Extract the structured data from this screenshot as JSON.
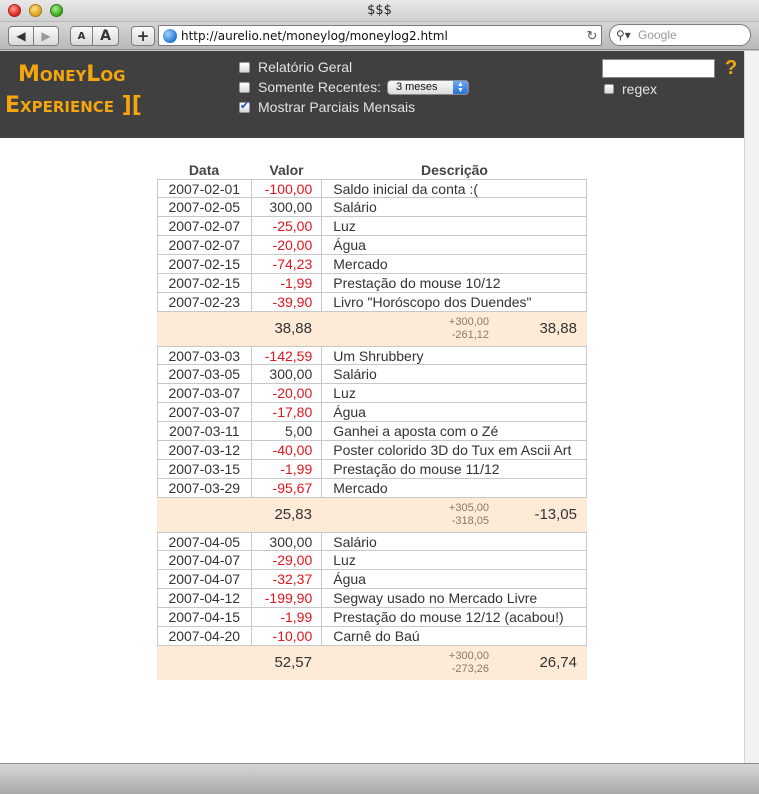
{
  "window": {
    "title": "$$$"
  },
  "toolbar": {
    "back_icon": "◀",
    "forward_icon": "▶",
    "font_smaller": "A",
    "font_larger": "A",
    "add_label": "+",
    "url": "http://aurelio.net/moneylog/moneylog2.html",
    "reload_icon": "↻",
    "search_placeholder": "Google"
  },
  "header": {
    "logo_line1": "MoneyLog",
    "logo_line2": "Experience ][",
    "options": {
      "relatorio_geral": {
        "label": "Relatório Geral",
        "checked": false
      },
      "somente_recentes": {
        "label": "Somente Recentes:",
        "checked": false,
        "select_value": "3 meses"
      },
      "mostrar_parciais": {
        "label": "Mostrar Parciais Mensais",
        "checked": true
      }
    },
    "filter_value": "",
    "help": "?",
    "regex_label": "regex"
  },
  "table": {
    "headers": {
      "date": "Data",
      "value": "Valor",
      "desc": "Descrição"
    },
    "months": [
      {
        "rows": [
          {
            "date": "2007-02-01",
            "value": "-100,00",
            "desc": "Saldo inicial da conta :(",
            "negative": true
          },
          {
            "date": "2007-02-05",
            "value": "300,00",
            "desc": "Salário",
            "negative": false
          },
          {
            "date": "2007-02-07",
            "value": "-25,00",
            "desc": "Luz",
            "negative": true
          },
          {
            "date": "2007-02-07",
            "value": "-20,00",
            "desc": "Água",
            "negative": true
          },
          {
            "date": "2007-02-15",
            "value": "-74,23",
            "desc": "Mercado",
            "negative": true
          },
          {
            "date": "2007-02-15",
            "value": "-1,99",
            "desc": "Prestação do mouse 10/12",
            "negative": true
          },
          {
            "date": "2007-02-23",
            "value": "-39,90",
            "desc": "Livro \"Horóscopo dos Duendes\"",
            "negative": true
          }
        ],
        "subtotal": {
          "partial": "38,88",
          "plus": "+300,00",
          "minus": "-261,12",
          "total": "38,88",
          "total_negative": false
        }
      },
      {
        "rows": [
          {
            "date": "2007-03-03",
            "value": "-142,59",
            "desc": "Um Shrubbery",
            "negative": true
          },
          {
            "date": "2007-03-05",
            "value": "300,00",
            "desc": "Salário",
            "negative": false
          },
          {
            "date": "2007-03-07",
            "value": "-20,00",
            "desc": "Luz",
            "negative": true
          },
          {
            "date": "2007-03-07",
            "value": "-17,80",
            "desc": "Água",
            "negative": true
          },
          {
            "date": "2007-03-11",
            "value": "5,00",
            "desc": "Ganhei a aposta com o Zé",
            "negative": false
          },
          {
            "date": "2007-03-12",
            "value": "-40,00",
            "desc": "Poster colorido 3D do Tux em Ascii Art",
            "negative": true
          },
          {
            "date": "2007-03-15",
            "value": "-1,99",
            "desc": "Prestação do mouse 11/12",
            "negative": true
          },
          {
            "date": "2007-03-29",
            "value": "-95,67",
            "desc": "Mercado",
            "negative": true
          }
        ],
        "subtotal": {
          "partial": "25,83",
          "plus": "+305,00",
          "minus": "-318,05",
          "total": "-13,05",
          "total_negative": true
        }
      },
      {
        "rows": [
          {
            "date": "2007-04-05",
            "value": "300,00",
            "desc": "Salário",
            "negative": false
          },
          {
            "date": "2007-04-07",
            "value": "-29,00",
            "desc": "Luz",
            "negative": true
          },
          {
            "date": "2007-04-07",
            "value": "-32,37",
            "desc": "Água",
            "negative": true
          },
          {
            "date": "2007-04-12",
            "value": "-199,90",
            "desc": "Segway usado no Mercado Livre",
            "negative": true
          },
          {
            "date": "2007-04-15",
            "value": "-1,99",
            "desc": "Prestação do mouse 12/12 (acabou!)",
            "negative": true
          },
          {
            "date": "2007-04-20",
            "value": "-10,00",
            "desc": "Carnê do Baú",
            "negative": true
          }
        ],
        "subtotal": {
          "partial": "52,57",
          "plus": "+300,00",
          "minus": "-273,26",
          "total": "26,74",
          "total_negative": false
        }
      }
    ]
  }
}
